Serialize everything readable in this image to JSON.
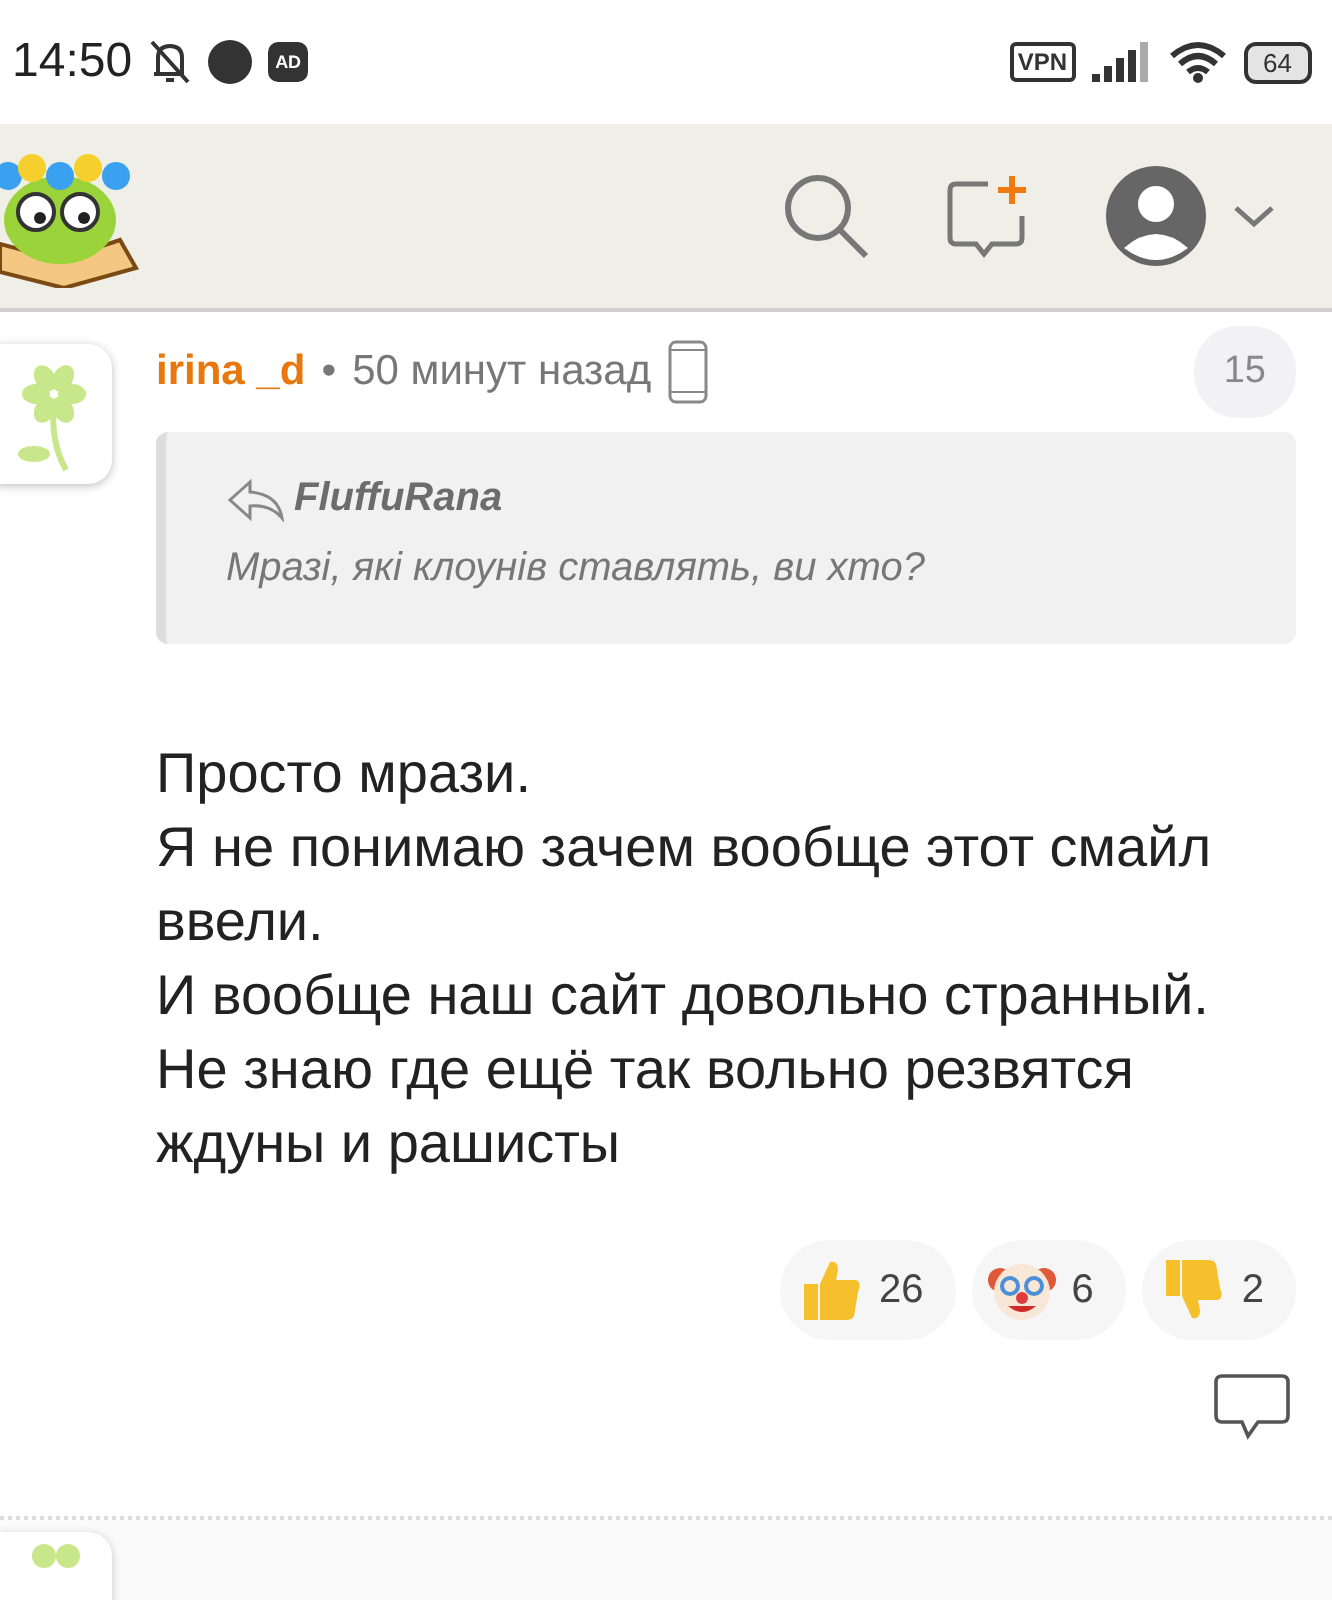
{
  "status_bar": {
    "time": "14:50",
    "adblock_label": "AD",
    "vpn": "VPN",
    "battery": "64"
  },
  "comment": {
    "author": "irina _d",
    "separator": "•",
    "time": "50 минут назад",
    "rating": "15",
    "quote": {
      "author": "FluffuRana",
      "text": "Мразі, які клоунів ставлять, ви хто?"
    },
    "paragraphs": [
      "Просто мрази.",
      "Я не понимаю зачем вообще этот смайл ввели.",
      "И вообще наш сайт довольно странный.",
      "Не знаю где ещё так вольно резвятся ждуны и рашисты"
    ],
    "reactions": [
      {
        "kind": "like",
        "count": "26"
      },
      {
        "kind": "clown",
        "count": "6"
      },
      {
        "kind": "dislike",
        "count": "2"
      }
    ]
  }
}
